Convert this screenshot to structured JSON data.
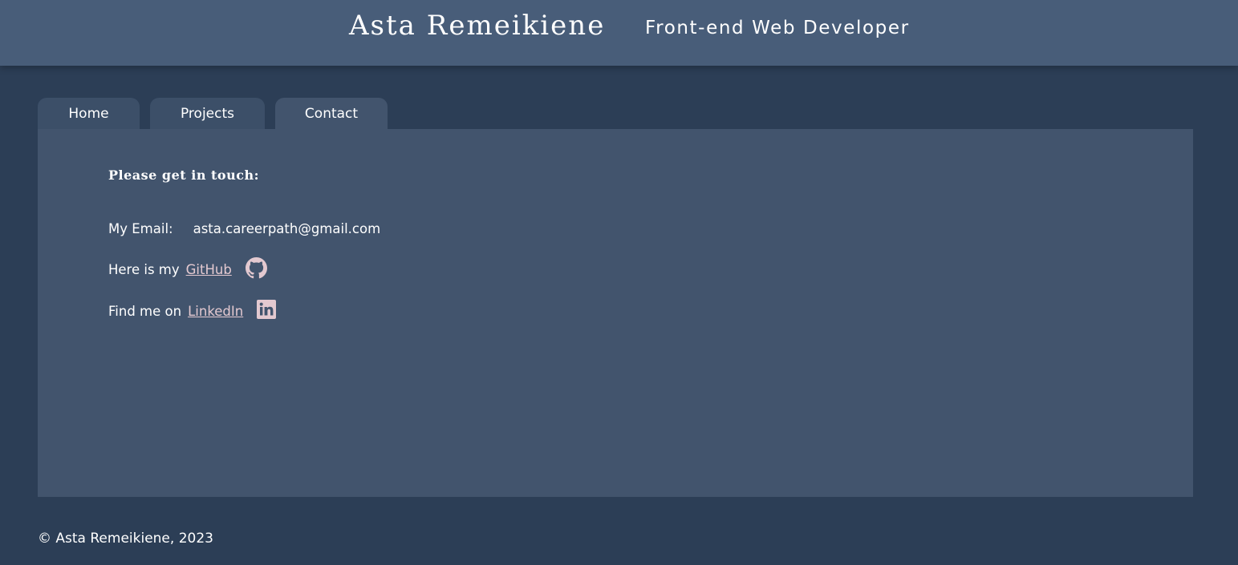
{
  "header": {
    "title": "Asta Remeikiene",
    "subtitle": "Front-end Web Developer"
  },
  "tabs": [
    {
      "label": "Home",
      "active": false
    },
    {
      "label": "Projects",
      "active": false
    },
    {
      "label": "Contact",
      "active": true
    }
  ],
  "contact": {
    "heading": "Please get in touch:",
    "email_label": "My Email:",
    "email_value": "asta.careerpath@gmail.com",
    "github_prefix": "Here is my",
    "github_link": "GitHub",
    "github_icon": "github-icon",
    "linkedin_prefix": "Find me on",
    "linkedin_link": "LinkedIn",
    "linkedin_icon": "linkedin-icon"
  },
  "footer": {
    "copyright": "© Asta Remeikiene, 2023"
  },
  "colors": {
    "background": "#2c3e56",
    "header": "#485d79",
    "panel": "#42546d",
    "tab": "#3c4f68",
    "link": "#e3c9d0",
    "icon": "#e3c9d0"
  }
}
